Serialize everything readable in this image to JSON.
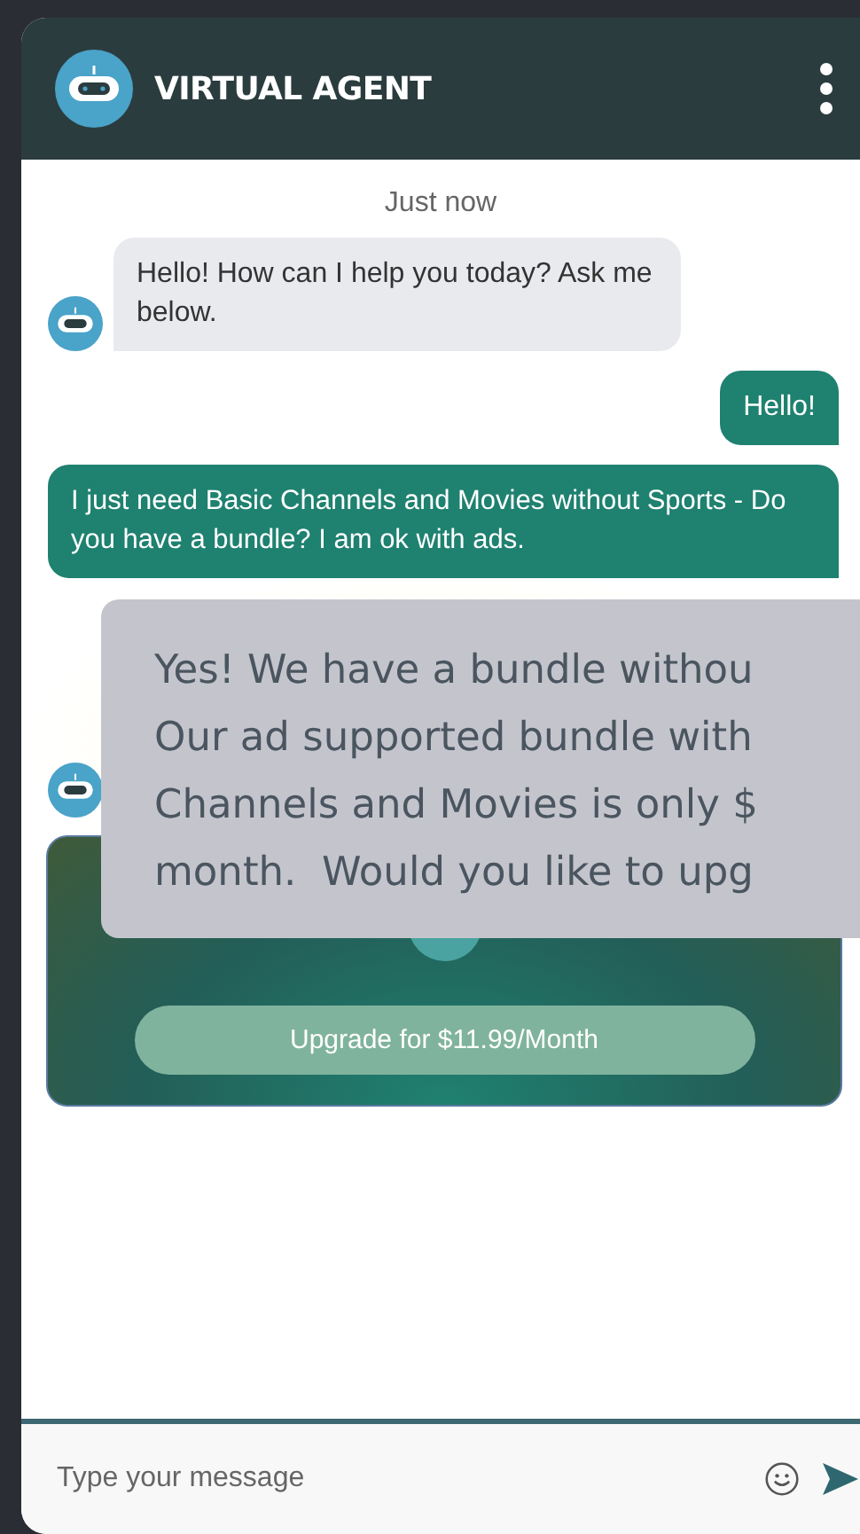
{
  "header": {
    "title": "VIRTUAL AGENT"
  },
  "timestamp": "Just now",
  "messages": [
    {
      "kind": "bot",
      "text": "Hello! How can I help you today? Ask me below."
    },
    {
      "kind": "user",
      "text": "Hello!"
    },
    {
      "kind": "user",
      "text": "I just need Basic Channels and Movies without Sports - Do you have a bundle? I am ok with ads."
    }
  ],
  "offer_card": {
    "button": "Upgrade for $11.99/Month"
  },
  "popup_bubble": {
    "lines": [
      "Yes! We have a bundle withou",
      "Our ad supported bundle with",
      "Channels and Movies is only $",
      "month.  Would you like to upg"
    ]
  },
  "composer": {
    "placeholder": "Type your message"
  }
}
